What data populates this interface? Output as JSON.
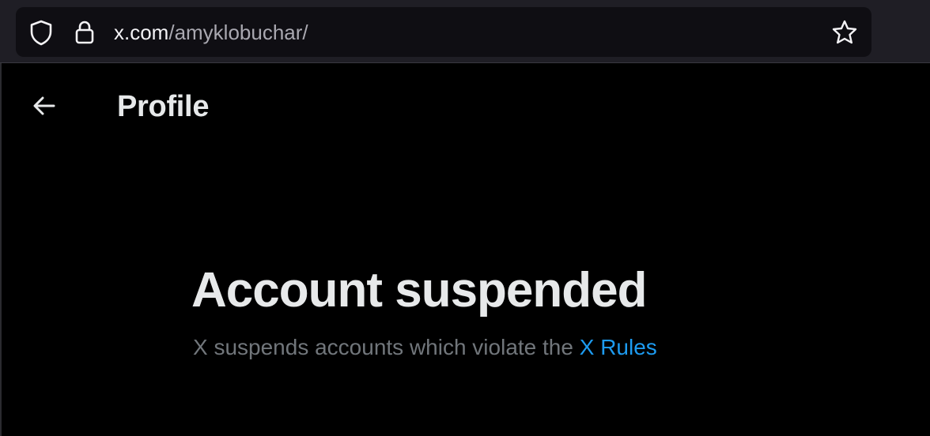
{
  "browser": {
    "url_domain": "x.com",
    "url_path": "/amyklobuchar/",
    "icons": {
      "left": [
        "shield-icon",
        "lock-icon"
      ],
      "right": [
        "star-icon"
      ]
    }
  },
  "header": {
    "back_icon": "arrow-left-icon",
    "title": "Profile"
  },
  "main": {
    "title": "Account suspended",
    "description_prefix": "X suspends accounts which violate the ",
    "rules_link": "X Rules"
  },
  "colors": {
    "background": "#000000",
    "text_primary": "#e7e9ea",
    "text_secondary": "#71767b",
    "link": "#1d9bf0",
    "browser_bar": "#1f1e25",
    "url_field": "#0f0e13"
  }
}
